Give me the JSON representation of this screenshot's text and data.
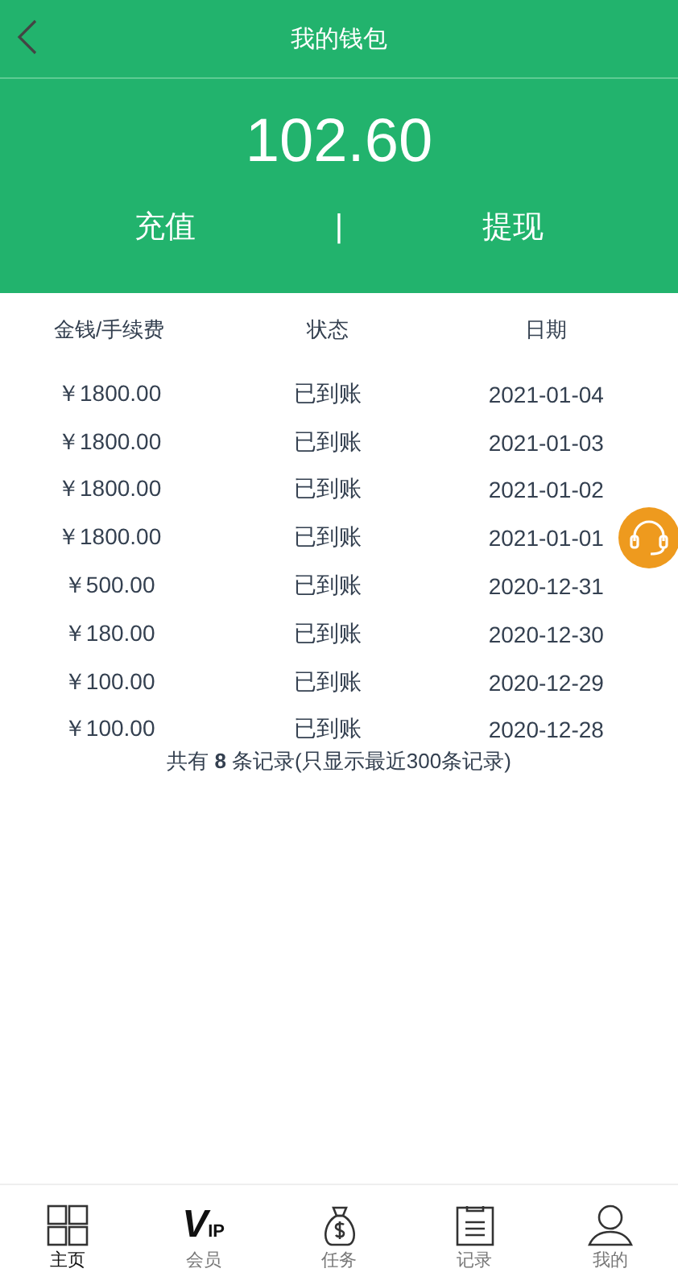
{
  "header": {
    "title": "我的钱包"
  },
  "balance": "102.60",
  "actions": [
    {
      "label": "充值"
    },
    {
      "label": "提现"
    }
  ],
  "separator": "|",
  "table": {
    "columns": [
      "金钱/手续费",
      "状态",
      "日期"
    ],
    "rows": [
      [
        "￥1800.00",
        "已到账",
        "2021-01-04"
      ],
      [
        "￥1800.00",
        "已到账",
        "2021-01-03"
      ],
      [
        "￥1800.00",
        "已到账",
        "2021-01-02"
      ],
      [
        "￥1800.00",
        "已到账",
        "2021-01-01"
      ],
      [
        "￥500.00",
        "已到账",
        "2020-12-31"
      ],
      [
        "￥180.00",
        "已到账",
        "2020-12-30"
      ],
      [
        "￥100.00",
        "已到账",
        "2020-12-29"
      ],
      [
        "￥100.00",
        "已到账",
        "2020-12-28"
      ]
    ]
  },
  "summary": "共有 **8** 条记录(只显示最近300条记录)",
  "nav": [
    {
      "kind": "home",
      "label": "主页",
      "selected": true
    },
    {
      "kind": "vip",
      "label": "会员",
      "icon_text": "V",
      "icon_text_2": "IP",
      "selected": false
    },
    {
      "kind": "task",
      "label": "任务",
      "selected": false
    },
    {
      "kind": "record",
      "label": "记录",
      "selected": false
    },
    {
      "kind": "me",
      "label": "我的",
      "selected": false
    }
  ]
}
